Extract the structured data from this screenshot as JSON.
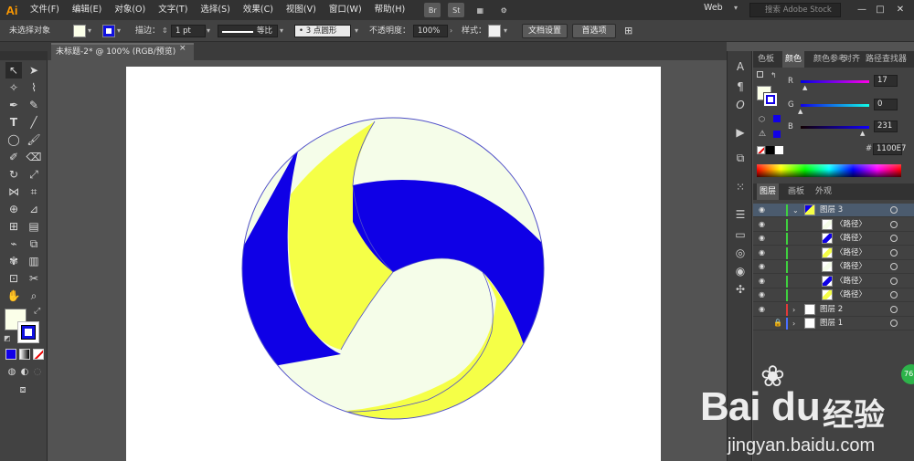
{
  "app": {
    "logo": "Ai"
  },
  "menu": [
    "文件(F)",
    "编辑(E)",
    "对象(O)",
    "文字(T)",
    "选择(S)",
    "效果(C)",
    "视图(V)",
    "窗口(W)",
    "帮助(H)"
  ],
  "menubar_icons": {
    "bridge": "Br",
    "stock": "St",
    "arrange": "▦",
    "sync": "⚙"
  },
  "workspace": {
    "label": "Web"
  },
  "search": {
    "placeholder": "搜索 Adobe Stock"
  },
  "window_buttons": [
    "—",
    "□",
    "✕"
  ],
  "control": {
    "selection_label": "未选择对象",
    "fill_color": "#fbffe9",
    "stroke_color": "#1010e0",
    "stroke_label": "描边：",
    "stroke_weight": "1 pt",
    "profile_label": "等比",
    "brush_label": "3 点圆形",
    "opacity_label": "不透明度：",
    "opacity_value": "100%",
    "style_label": "样式：",
    "doc_settings_button": "文档设置",
    "prefs_button": "首选项"
  },
  "document_tab": {
    "title": "未标题-2* @ 100% (RGB/预览)",
    "close": "×"
  },
  "artwork": {
    "colors": {
      "blue": "#0f00e6",
      "yellow": "#f5ff47",
      "cream": "#f5fde9",
      "outline": "#5050c8"
    }
  },
  "color_panel": {
    "tabs": [
      "色板",
      "颜色",
      "颜色参考",
      "对齐",
      "路径查找器"
    ],
    "r": {
      "label": "R",
      "value": "17",
      "fraction": 0.067
    },
    "g": {
      "label": "G",
      "value": "0",
      "fraction": 0.0
    },
    "b": {
      "label": "B",
      "value": "231",
      "fraction": 0.906
    },
    "hex_label": "#",
    "hex_value": "1100E7"
  },
  "layers_panel": {
    "tabs": [
      "图层",
      "画板",
      "外观"
    ],
    "layers": [
      {
        "name": "图层 3",
        "visible": true,
        "expanded": true,
        "selected": true,
        "color": "#3fcf3f"
      },
      {
        "name": "〈路径〉",
        "indent": true,
        "thumb": "cream"
      },
      {
        "name": "〈路径〉",
        "indent": true,
        "thumb": "blue"
      },
      {
        "name": "〈路径〉",
        "indent": true,
        "thumb": "yellow"
      },
      {
        "name": "〈路径〉",
        "indent": true,
        "thumb": "cream"
      },
      {
        "name": "〈路径〉",
        "indent": true,
        "thumb": "blue"
      },
      {
        "name": "〈路径〉",
        "indent": true,
        "thumb": "yellow"
      },
      {
        "name": "图层 2",
        "visible": true,
        "color": "#e03a3a"
      },
      {
        "name": "图层 1",
        "visible": false,
        "locked": true,
        "color": "#4a6fff"
      }
    ]
  },
  "watermark": {
    "brand_a": "Bai",
    "brand_b": "du",
    "brand_c": "经验",
    "url": "jingyan.baidu.com",
    "badge": "76"
  }
}
